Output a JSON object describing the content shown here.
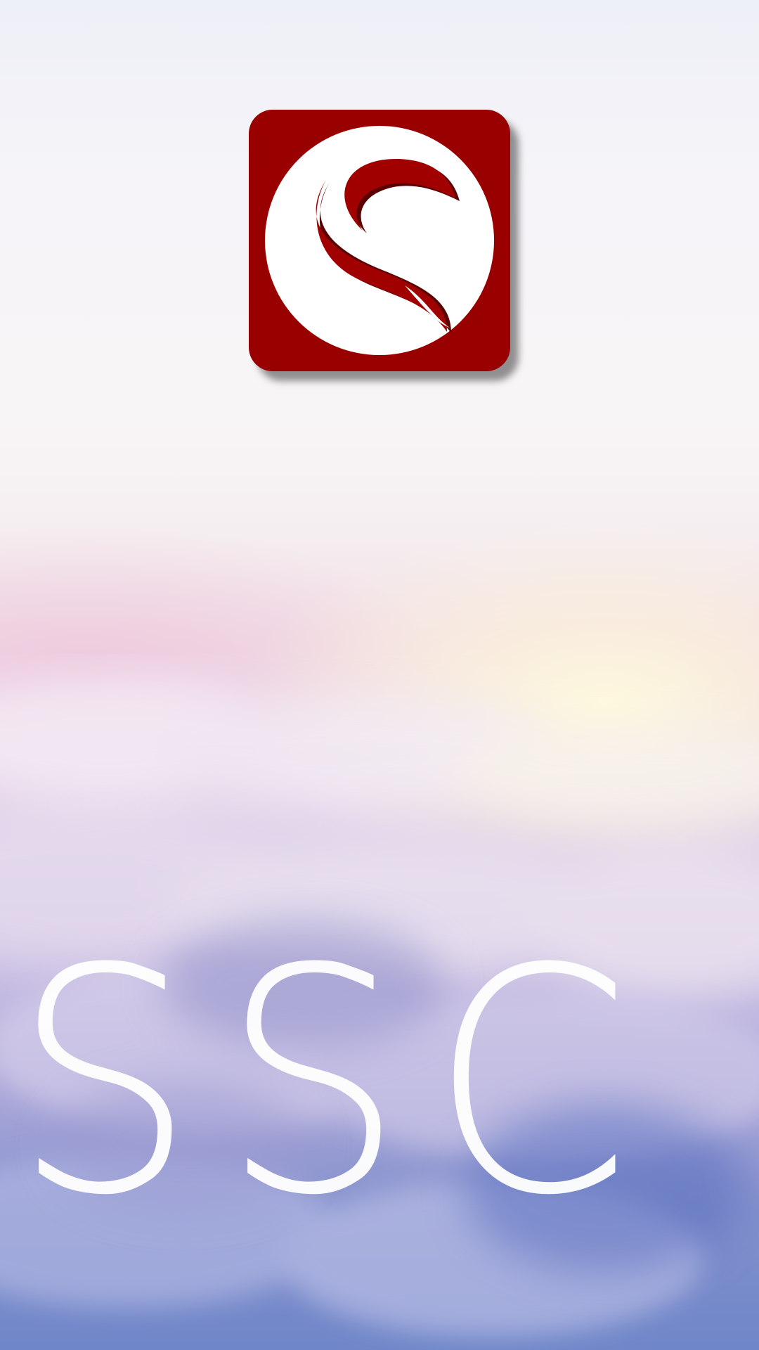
{
  "splash": {
    "brand_text": "SSC",
    "logo_icon": "ssc-s-logo-icon",
    "background": "sky-clouds-sunrise"
  },
  "colors": {
    "logo_background": "#990000",
    "logo_disc": "#ffffff",
    "wordmark": "#ffffff",
    "sky_top": "#eef0f7",
    "sky_bottom": "#6f86c8"
  }
}
